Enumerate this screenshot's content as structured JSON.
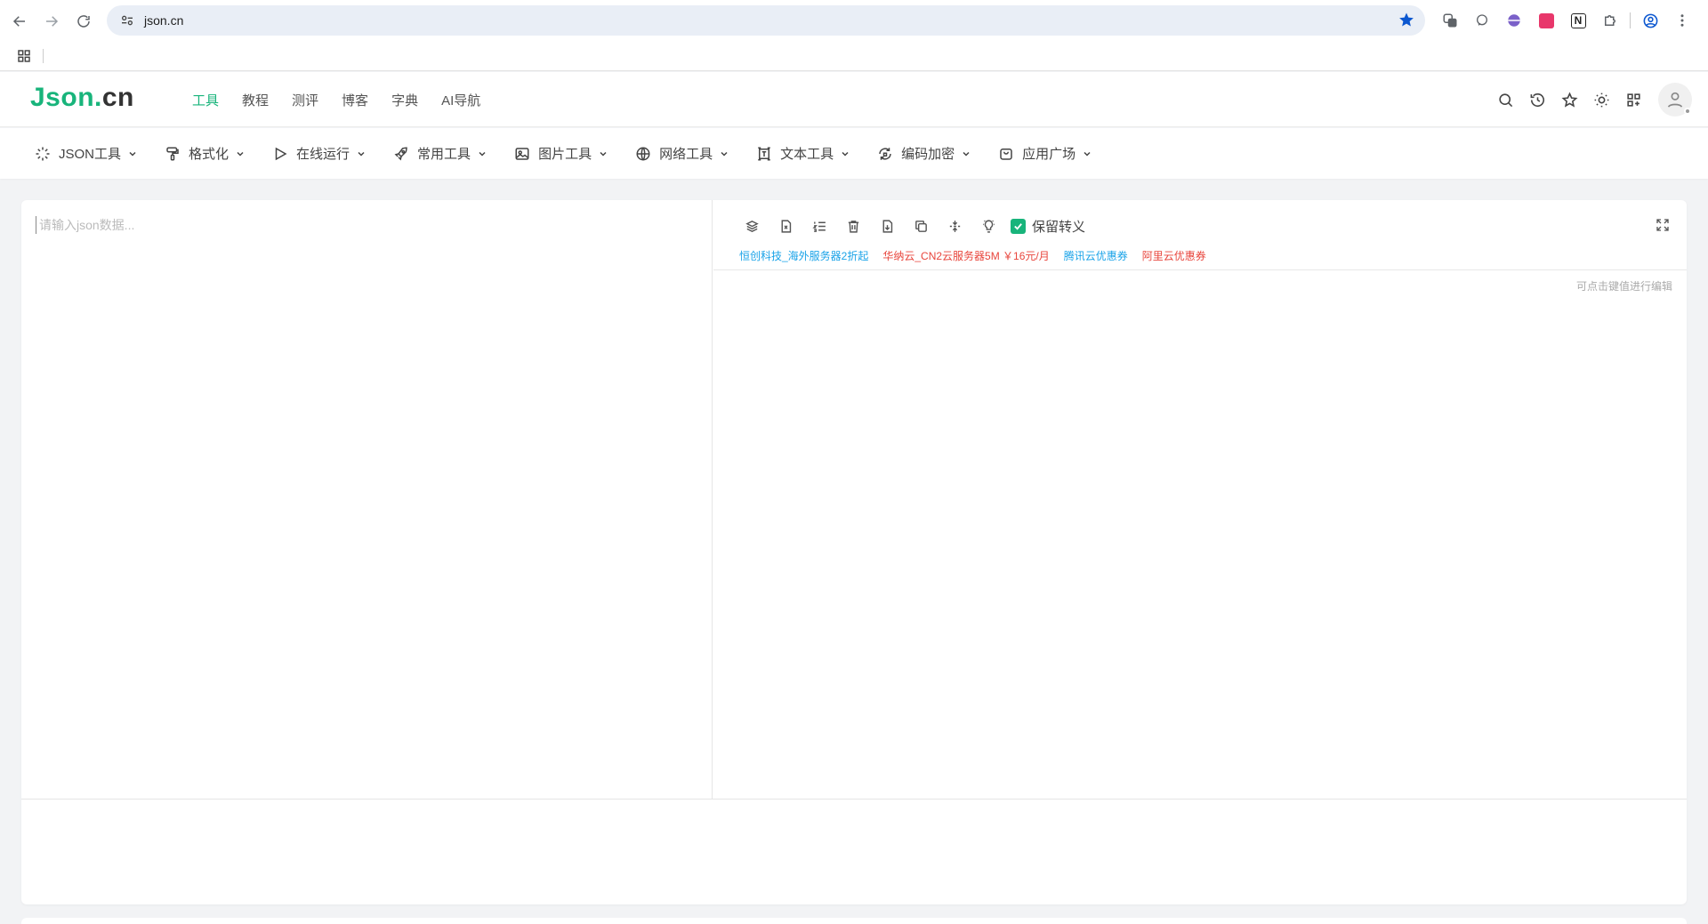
{
  "browser": {
    "url": "json.cn",
    "extensions": [
      "tab-search-icon",
      "chat-icon",
      "globe-ext-icon",
      "translate-ext-icon",
      "notion-icon",
      "puzzle-icon",
      "profile-icon",
      "more-icon"
    ],
    "notion_label": "N"
  },
  "site": {
    "logo_main": "Json",
    "logo_dot": ".",
    "logo_tld": "cn",
    "nav": [
      {
        "label": "工具",
        "active": true
      },
      {
        "label": "教程",
        "active": false
      },
      {
        "label": "测评",
        "active": false
      },
      {
        "label": "博客",
        "active": false
      },
      {
        "label": "字典",
        "active": false
      },
      {
        "label": "AI导航",
        "active": false
      }
    ],
    "accent_color": "#18b47b"
  },
  "tool_menu": [
    {
      "label": "JSON工具",
      "icon": "sparkle-icon"
    },
    {
      "label": "格式化",
      "icon": "paint-roller-icon"
    },
    {
      "label": "在线运行",
      "icon": "play-icon"
    },
    {
      "label": "常用工具",
      "icon": "rocket-icon"
    },
    {
      "label": "图片工具",
      "icon": "image-icon"
    },
    {
      "label": "网络工具",
      "icon": "globe-icon"
    },
    {
      "label": "文本工具",
      "icon": "text-frame-icon"
    },
    {
      "label": "编码加密",
      "icon": "refresh-lock-icon"
    },
    {
      "label": "应用广场",
      "icon": "bag-icon"
    }
  ],
  "editor": {
    "placeholder": "请输入json数据...",
    "escape_label": "保留转义",
    "escape_checked": true,
    "hint": "可点击键值进行编辑",
    "promos": [
      {
        "text": "恒创科技_海外服务器2折起",
        "color": "blue"
      },
      {
        "text": "华纳云_CN2云服务器5M ￥16元/月",
        "color": "red"
      },
      {
        "text": "腾讯云优惠券",
        "color": "blue"
      },
      {
        "text": "阿里云优惠券",
        "color": "red"
      }
    ]
  }
}
